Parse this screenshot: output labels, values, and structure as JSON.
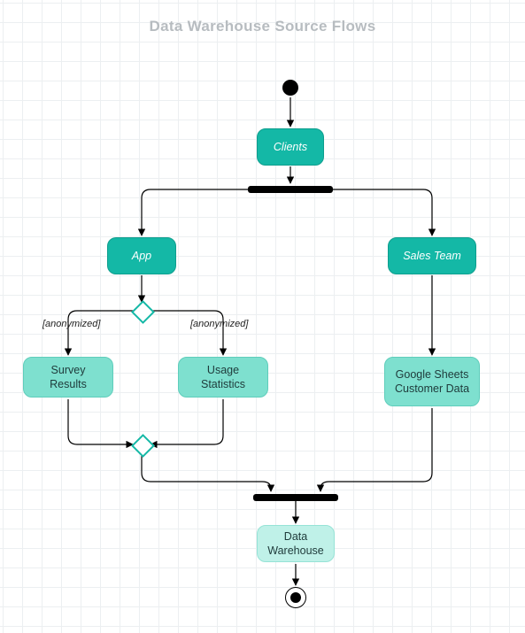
{
  "title": "Data Warehouse Source Flows",
  "nodes": {
    "clients": "Clients",
    "app": "App",
    "sales": "Sales Team",
    "survey": "Survey Results",
    "usage": "Usage\nStatistics",
    "gsheets": "Google Sheets\nCustomer Data",
    "dw": "Data\nWarehouse"
  },
  "edge_labels": {
    "anon_left": "[anonymized]",
    "anon_right": "[anonymized]"
  }
}
